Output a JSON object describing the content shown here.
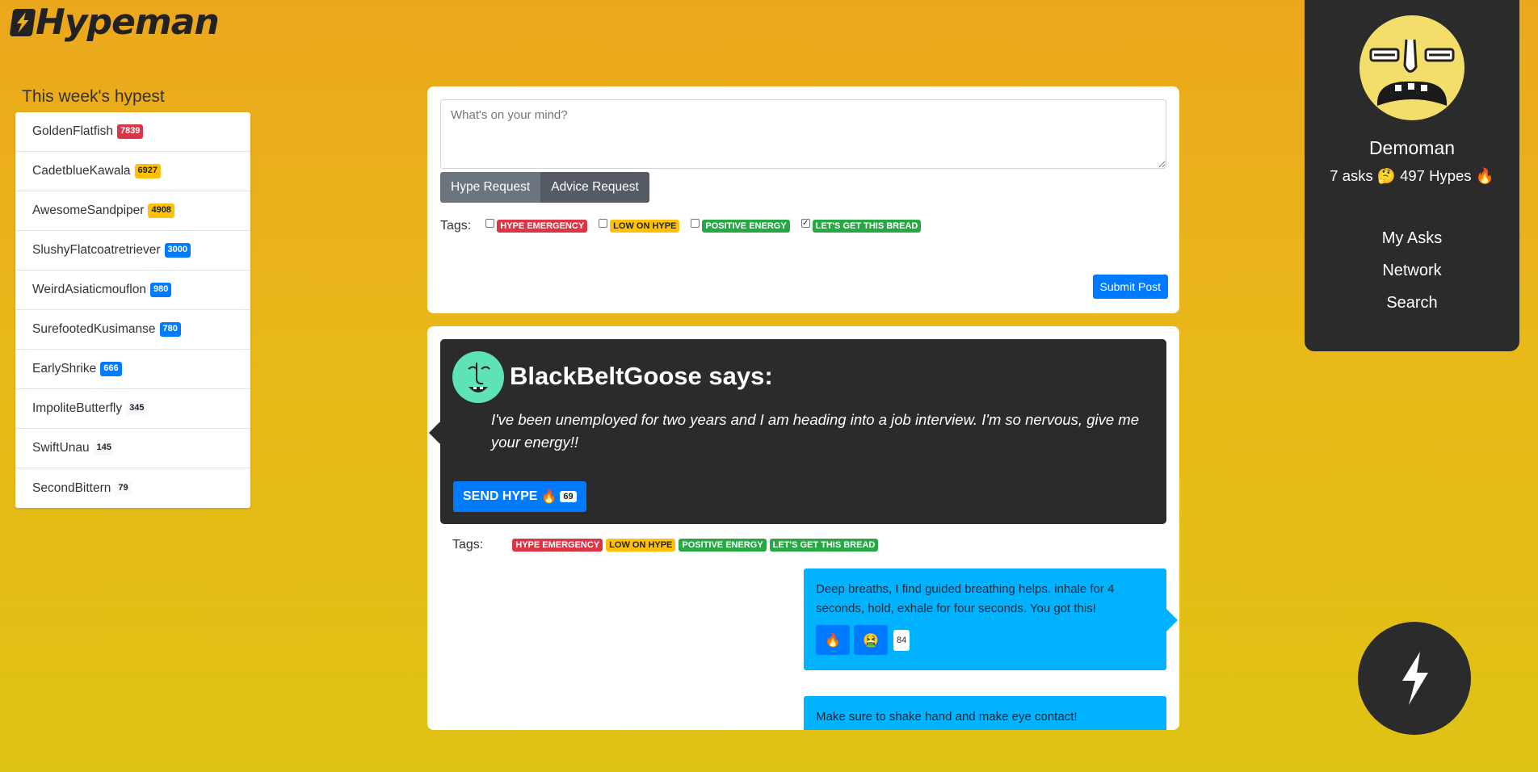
{
  "app": {
    "title": "Hypeman"
  },
  "leaderboard": {
    "title": "This week's hypest",
    "items": [
      {
        "name": "GoldenFlatfish",
        "score": "7839",
        "color": "#dc3545"
      },
      {
        "name": "CadetblueKawala",
        "score": "6927",
        "color": "#ffc107"
      },
      {
        "name": "AwesomeSandpiper",
        "score": "4908",
        "color": "#ffc107"
      },
      {
        "name": "SlushyFlatcoatretriever",
        "score": "3000",
        "color": "#007bff"
      },
      {
        "name": "WeirdAsiaticmouflon",
        "score": "980",
        "color": "#007bff"
      },
      {
        "name": "SurefootedKusimanse",
        "score": "780",
        "color": "#007bff"
      },
      {
        "name": "EarlyShrike",
        "score": "666",
        "color": "#007bff"
      },
      {
        "name": "ImpoliteButterfly",
        "score": "345",
        "color": "#f8f9fa"
      },
      {
        "name": "SwiftUnau",
        "score": "145",
        "color": "#f8f9fa"
      },
      {
        "name": "SecondBittern",
        "score": "79",
        "color": "#f8f9fa"
      }
    ]
  },
  "post_form": {
    "placeholder": "What's on your mind?",
    "hype_request_label": "Hype Request",
    "advice_request_label": "Advice Request",
    "tags_label": "Tags:",
    "tags": [
      {
        "label": "HYPE EMERGENCY",
        "checked": false
      },
      {
        "label": "LOW ON HYPE",
        "checked": false
      },
      {
        "label": "POSITIVE ENERGY",
        "checked": false
      },
      {
        "label": "LET'S GET THIS BREAD",
        "checked": true
      }
    ],
    "submit_label": "Submit Post"
  },
  "feed": {
    "post": {
      "author_line": "BlackBeltGoose says:",
      "text": "I've been unemployed for two years and I am heading into a job interview. I'm so nervous, give me your energy!!",
      "send_hype_label": "SEND HYPE",
      "send_hype_emoji": "🔥",
      "hype_count": "69",
      "tags_label": "Tags:",
      "tags": [
        "HYPE EMERGENCY",
        "LOW ON HYPE",
        "POSITIVE ENERGY",
        "LET'S GET THIS BREAD"
      ]
    },
    "replies": [
      {
        "text": "Deep breaths, I find guided breathing helps. inhale for 4 seconds, hold, exhale for four seconds. You got this!",
        "reaction_1": "🔥",
        "reaction_2": "🤮",
        "count": "84"
      },
      {
        "text": "Make sure to shake hand and make eye contact!"
      }
    ]
  },
  "profile": {
    "name": "Demoman",
    "asks": "7 asks",
    "asks_emoji": "🤔",
    "hypes": "497 Hypes",
    "hypes_emoji": "🔥",
    "nav": [
      "My Asks",
      "Network",
      "Search"
    ]
  },
  "icons": {
    "logo": "lightning-bolt-icon",
    "fab": "lightning-bolt-icon"
  }
}
